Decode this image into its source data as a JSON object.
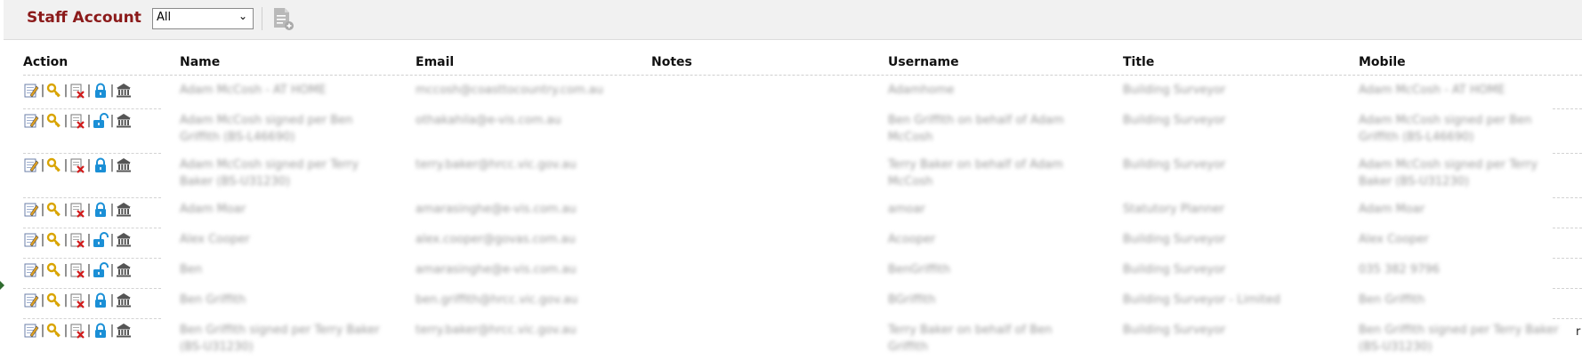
{
  "toolbar": {
    "title": "Staff Account",
    "filter_value": "All",
    "add_icon": "document-add-icon"
  },
  "columns": {
    "action": "Action",
    "name": "Name",
    "email": "Email",
    "notes": "Notes",
    "username": "Username",
    "title": "Title",
    "mobile": "Mobile"
  },
  "action_icons": [
    "edit-icon",
    "key-icon",
    "delete-icon",
    "lock-icon",
    "bank-icon"
  ],
  "rows": [
    {
      "name": "Adam McCosh - AT HOME",
      "email": "mccosh@coasttocountry.com.au",
      "notes": "",
      "username": "Adamhome",
      "title": "Building Surveyor",
      "mobile": "Adam McCosh - AT HOME",
      "lock": "locked"
    },
    {
      "name": "Adam McCosh signed per Ben Griffith (BS-L46690)",
      "email": "othakahila@e-vis.com.au",
      "notes": "",
      "username": "Ben Griffith on behalf of Adam McCosh",
      "title": "Building Surveyor",
      "mobile": "Adam McCosh signed per Ben Griffith (BS-L46690)",
      "lock": "unlocked"
    },
    {
      "name": "Adam McCosh signed per Terry Baker (BS-U31230)",
      "email": "terry.baker@hrcc.vic.gov.au",
      "notes": "",
      "username": "Terry Baker on behalf of Adam McCosh",
      "title": "Building Surveyor",
      "mobile": "Adam McCosh signed per Terry Baker (BS-U31230)",
      "lock": "locked"
    },
    {
      "name": "Adam Moar",
      "email": "amarasinghe@e-vis.com.au",
      "notes": "",
      "username": "amoar",
      "title": "Statutory Planner",
      "mobile": "Adam Moar",
      "lock": "locked"
    },
    {
      "name": "Alex Cooper",
      "email": "alex.cooper@govas.com.au",
      "notes": "",
      "username": "Acooper",
      "title": "Building Surveyor",
      "mobile": "Alex Cooper",
      "lock": "unlocked"
    },
    {
      "name": "Ben",
      "email": "amarasinghe@e-vis.com.au",
      "notes": "",
      "username": "BenGriffith",
      "title": "Building Surveyor",
      "mobile": "035 382 9796",
      "lock": "unlocked"
    },
    {
      "name": "Ben Griffith",
      "email": "ben.griffith@hrcc.vic.gov.au",
      "notes": "",
      "username": "BGriffith",
      "title": "Building Surveyor - Limited",
      "mobile": "Ben Griffith",
      "lock": "locked"
    },
    {
      "name": "Ben Griffith signed per Terry Baker (BS-U31230)",
      "email": "terry.baker@hrcc.vic.gov.au",
      "notes": "",
      "username": "Terry Baker on behalf of Ben Griffith",
      "title": "Building Surveyor",
      "mobile": "Ben Griffith signed per Terry Baker (BS-U31230)",
      "lock": "locked"
    }
  ],
  "trailing_char": "r",
  "colors": {
    "title": "#8b1a1a",
    "lock_blue": "#1a8fd6",
    "key_gold": "#d9a400",
    "delete_red": "#d21b1b"
  }
}
